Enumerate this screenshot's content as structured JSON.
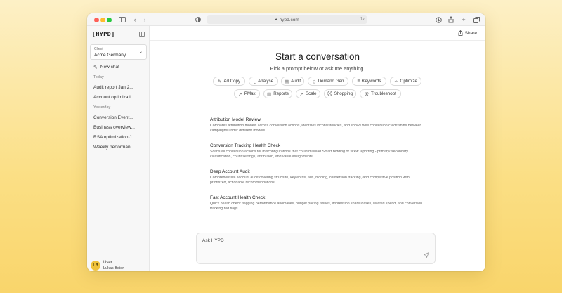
{
  "browser": {
    "url": "hypd.com"
  },
  "sidebar": {
    "logo": "[HYPD]",
    "client_label": "Client",
    "client_value": "Acme Germany",
    "new_chat": "New chat",
    "sections": [
      {
        "label": "Today",
        "items": [
          "Audit report Jan 2...",
          "Account optimizati..."
        ]
      },
      {
        "label": "Yesterday",
        "items": [
          "Conversion Event...",
          "Business overview...",
          "RSA optimization J...",
          "Weekly performan..."
        ]
      }
    ],
    "user": {
      "initials": "LB",
      "role": "User",
      "name": "Lukas Beier"
    }
  },
  "header": {
    "share": "Share"
  },
  "main": {
    "title": "Start a conversation",
    "subtitle": "Pick a prompt below or ask me anything.",
    "chips_row1": [
      {
        "label": "Ad Copy",
        "icon": "pencil-icon"
      },
      {
        "label": "Analyse",
        "icon": "chart-icon"
      },
      {
        "label": "Audit",
        "icon": "clipboard-icon"
      },
      {
        "label": "Demand Gen",
        "icon": "tag-icon"
      },
      {
        "label": "Keywords",
        "icon": "list-icon"
      },
      {
        "label": "Optimize",
        "icon": "sparkle-icon"
      }
    ],
    "chips_row2": [
      {
        "label": "PMax",
        "icon": "rocket-icon"
      },
      {
        "label": "Reports",
        "icon": "bar-chart-icon"
      },
      {
        "label": "Scale",
        "icon": "trend-icon"
      },
      {
        "label": "Shopping",
        "icon": "cart-icon"
      },
      {
        "label": "Troubleshoot",
        "icon": "wrench-icon"
      }
    ],
    "prompts": [
      {
        "title": "Attribution Model Review",
        "desc": "Compares attribution models across conversion actions, identifies inconsistencies, and shows how conversion credit shifts between campaigns under different models."
      },
      {
        "title": "Conversion Tracking Health Check",
        "desc": "Scans all conversion actions for misconfigurations that could mislead Smart Bidding or skew reporting - primary/ secondary classification, count settings, attribution, and value assignments."
      },
      {
        "title": "Deep Account Audit",
        "desc": "Comprehensive account audit covering structure, keywords, ads, bidding, conversion tracking, and competitive position with prioritized, actionable recommendations."
      },
      {
        "title": "Fast Account Health Check",
        "desc": "Quick health check flagging performance anomalies, budget pacing issues, impression share losses, wasted spend, and conversion tracking red flags."
      }
    ],
    "ask_placeholder": "Ask HYPD"
  }
}
